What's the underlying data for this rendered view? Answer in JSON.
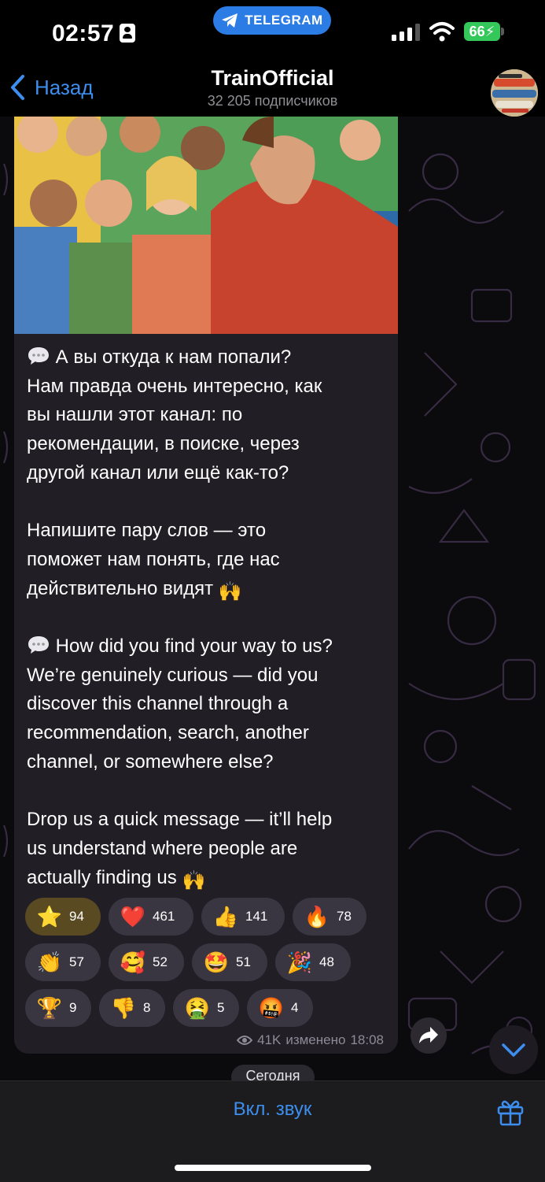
{
  "status_bar": {
    "time": "02:57",
    "app_pill": "TELEGRAM",
    "battery": "66"
  },
  "header": {
    "back_label": "Назад",
    "title": "TrainOfficial",
    "subtitle": "32 205 подписчиков"
  },
  "message": {
    "paragraphs_ru": [
      "А вы откуда к нам попали?",
      "Нам правда очень интересно, как",
      "вы нашли этот канал: по",
      "рекомендации, в поиске, через",
      "другой канал или ещё как-то?"
    ],
    "paragraph2_ru": [
      "Напишите пару слов — это",
      "поможет нам понять, где нас",
      "действительно видят"
    ],
    "paragraphs_en": [
      "How did you find your way to us?",
      "We’re genuinely curious — did you",
      "discover this channel through a",
      "recommendation, search, another",
      "channel, or somewhere else?"
    ],
    "paragraph2_en": [
      "Drop us a quick message — it’ll help",
      "us understand where people are",
      "actually finding us"
    ],
    "views": "41K",
    "edited_label": "изменено",
    "time": "18:08"
  },
  "reactions": [
    {
      "icon": "star-icon",
      "count": "94"
    },
    {
      "icon": "heart-icon",
      "count": "461"
    },
    {
      "icon": "thumbs-up-icon",
      "count": "141"
    },
    {
      "icon": "fire-icon",
      "count": "78"
    },
    {
      "icon": "clap-icon",
      "count": "57"
    },
    {
      "icon": "smiling-hearts-icon",
      "count": "52"
    },
    {
      "icon": "star-struck-icon",
      "count": "51"
    },
    {
      "icon": "party-popper-icon",
      "count": "48"
    },
    {
      "icon": "trophy-icon",
      "count": "9"
    },
    {
      "icon": "thumbs-down-icon",
      "count": "8"
    },
    {
      "icon": "vomiting-icon",
      "count": "5"
    },
    {
      "icon": "cursing-icon",
      "count": "4"
    }
  ],
  "date_separator": "Сегодня",
  "bottom": {
    "unmute_label": "Вкл. звук"
  },
  "colors": {
    "accent": "#3d8eee",
    "bubble": "#211e26",
    "battery": "#34c759"
  }
}
